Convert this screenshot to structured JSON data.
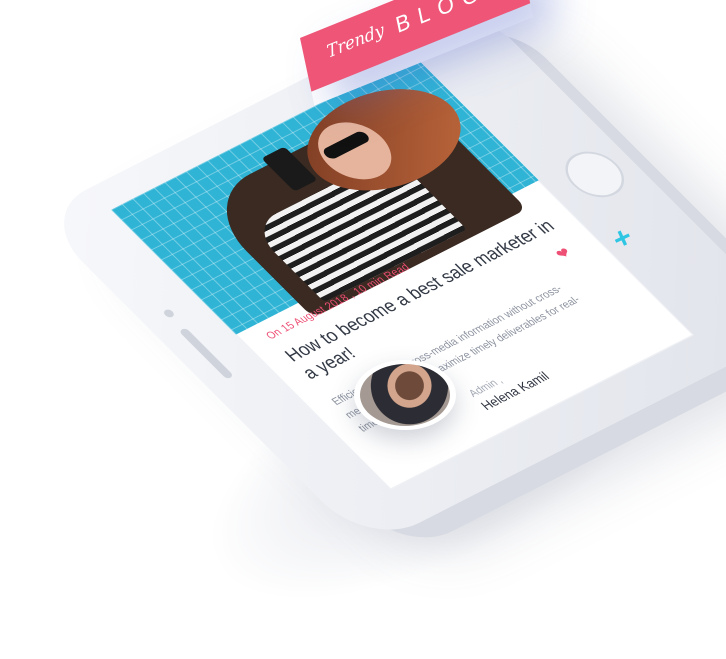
{
  "banner": {
    "script": "Trendy",
    "word": "BLOG"
  },
  "post": {
    "meta": "On 15 August 2018 , 10 min Read",
    "title": "How to become a best sale marketer in a year!",
    "excerpt": "Efficiently unleash cross-media information without cross-media value. Quickly maximize timely deliverables for real-time schemas."
  },
  "author": {
    "role": "Admin ,",
    "name": "Helena Kamil"
  },
  "colors": {
    "accent": "#ee5577",
    "plus": "#2fc6e3",
    "pool": "#2fb4d6"
  },
  "icons": {
    "heart": "heart-icon",
    "plus": "plus-icon"
  }
}
